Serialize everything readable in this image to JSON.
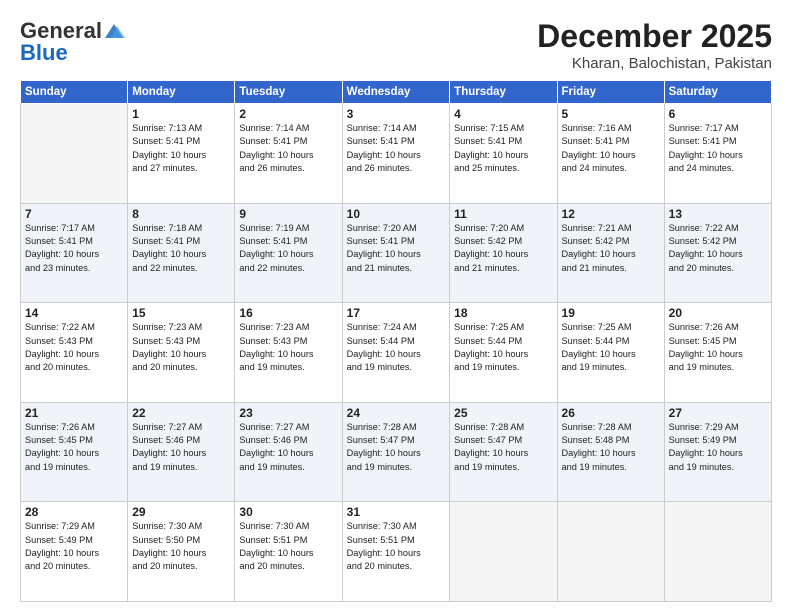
{
  "header": {
    "logo_general": "General",
    "logo_blue": "Blue",
    "month_title": "December 2025",
    "location": "Kharan, Balochistan, Pakistan"
  },
  "days_of_week": [
    "Sunday",
    "Monday",
    "Tuesday",
    "Wednesday",
    "Thursday",
    "Friday",
    "Saturday"
  ],
  "weeks": [
    {
      "shade": false,
      "days": [
        {
          "num": "",
          "info": ""
        },
        {
          "num": "1",
          "info": "Sunrise: 7:13 AM\nSunset: 5:41 PM\nDaylight: 10 hours\nand 27 minutes."
        },
        {
          "num": "2",
          "info": "Sunrise: 7:14 AM\nSunset: 5:41 PM\nDaylight: 10 hours\nand 26 minutes."
        },
        {
          "num": "3",
          "info": "Sunrise: 7:14 AM\nSunset: 5:41 PM\nDaylight: 10 hours\nand 26 minutes."
        },
        {
          "num": "4",
          "info": "Sunrise: 7:15 AM\nSunset: 5:41 PM\nDaylight: 10 hours\nand 25 minutes."
        },
        {
          "num": "5",
          "info": "Sunrise: 7:16 AM\nSunset: 5:41 PM\nDaylight: 10 hours\nand 24 minutes."
        },
        {
          "num": "6",
          "info": "Sunrise: 7:17 AM\nSunset: 5:41 PM\nDaylight: 10 hours\nand 24 minutes."
        }
      ]
    },
    {
      "shade": true,
      "days": [
        {
          "num": "7",
          "info": "Sunrise: 7:17 AM\nSunset: 5:41 PM\nDaylight: 10 hours\nand 23 minutes."
        },
        {
          "num": "8",
          "info": "Sunrise: 7:18 AM\nSunset: 5:41 PM\nDaylight: 10 hours\nand 22 minutes."
        },
        {
          "num": "9",
          "info": "Sunrise: 7:19 AM\nSunset: 5:41 PM\nDaylight: 10 hours\nand 22 minutes."
        },
        {
          "num": "10",
          "info": "Sunrise: 7:20 AM\nSunset: 5:41 PM\nDaylight: 10 hours\nand 21 minutes."
        },
        {
          "num": "11",
          "info": "Sunrise: 7:20 AM\nSunset: 5:42 PM\nDaylight: 10 hours\nand 21 minutes."
        },
        {
          "num": "12",
          "info": "Sunrise: 7:21 AM\nSunset: 5:42 PM\nDaylight: 10 hours\nand 21 minutes."
        },
        {
          "num": "13",
          "info": "Sunrise: 7:22 AM\nSunset: 5:42 PM\nDaylight: 10 hours\nand 20 minutes."
        }
      ]
    },
    {
      "shade": false,
      "days": [
        {
          "num": "14",
          "info": "Sunrise: 7:22 AM\nSunset: 5:43 PM\nDaylight: 10 hours\nand 20 minutes."
        },
        {
          "num": "15",
          "info": "Sunrise: 7:23 AM\nSunset: 5:43 PM\nDaylight: 10 hours\nand 20 minutes."
        },
        {
          "num": "16",
          "info": "Sunrise: 7:23 AM\nSunset: 5:43 PM\nDaylight: 10 hours\nand 19 minutes."
        },
        {
          "num": "17",
          "info": "Sunrise: 7:24 AM\nSunset: 5:44 PM\nDaylight: 10 hours\nand 19 minutes."
        },
        {
          "num": "18",
          "info": "Sunrise: 7:25 AM\nSunset: 5:44 PM\nDaylight: 10 hours\nand 19 minutes."
        },
        {
          "num": "19",
          "info": "Sunrise: 7:25 AM\nSunset: 5:44 PM\nDaylight: 10 hours\nand 19 minutes."
        },
        {
          "num": "20",
          "info": "Sunrise: 7:26 AM\nSunset: 5:45 PM\nDaylight: 10 hours\nand 19 minutes."
        }
      ]
    },
    {
      "shade": true,
      "days": [
        {
          "num": "21",
          "info": "Sunrise: 7:26 AM\nSunset: 5:45 PM\nDaylight: 10 hours\nand 19 minutes."
        },
        {
          "num": "22",
          "info": "Sunrise: 7:27 AM\nSunset: 5:46 PM\nDaylight: 10 hours\nand 19 minutes."
        },
        {
          "num": "23",
          "info": "Sunrise: 7:27 AM\nSunset: 5:46 PM\nDaylight: 10 hours\nand 19 minutes."
        },
        {
          "num": "24",
          "info": "Sunrise: 7:28 AM\nSunset: 5:47 PM\nDaylight: 10 hours\nand 19 minutes."
        },
        {
          "num": "25",
          "info": "Sunrise: 7:28 AM\nSunset: 5:47 PM\nDaylight: 10 hours\nand 19 minutes."
        },
        {
          "num": "26",
          "info": "Sunrise: 7:28 AM\nSunset: 5:48 PM\nDaylight: 10 hours\nand 19 minutes."
        },
        {
          "num": "27",
          "info": "Sunrise: 7:29 AM\nSunset: 5:49 PM\nDaylight: 10 hours\nand 19 minutes."
        }
      ]
    },
    {
      "shade": false,
      "days": [
        {
          "num": "28",
          "info": "Sunrise: 7:29 AM\nSunset: 5:49 PM\nDaylight: 10 hours\nand 20 minutes."
        },
        {
          "num": "29",
          "info": "Sunrise: 7:30 AM\nSunset: 5:50 PM\nDaylight: 10 hours\nand 20 minutes."
        },
        {
          "num": "30",
          "info": "Sunrise: 7:30 AM\nSunset: 5:51 PM\nDaylight: 10 hours\nand 20 minutes."
        },
        {
          "num": "31",
          "info": "Sunrise: 7:30 AM\nSunset: 5:51 PM\nDaylight: 10 hours\nand 20 minutes."
        },
        {
          "num": "",
          "info": ""
        },
        {
          "num": "",
          "info": ""
        },
        {
          "num": "",
          "info": ""
        }
      ]
    }
  ]
}
